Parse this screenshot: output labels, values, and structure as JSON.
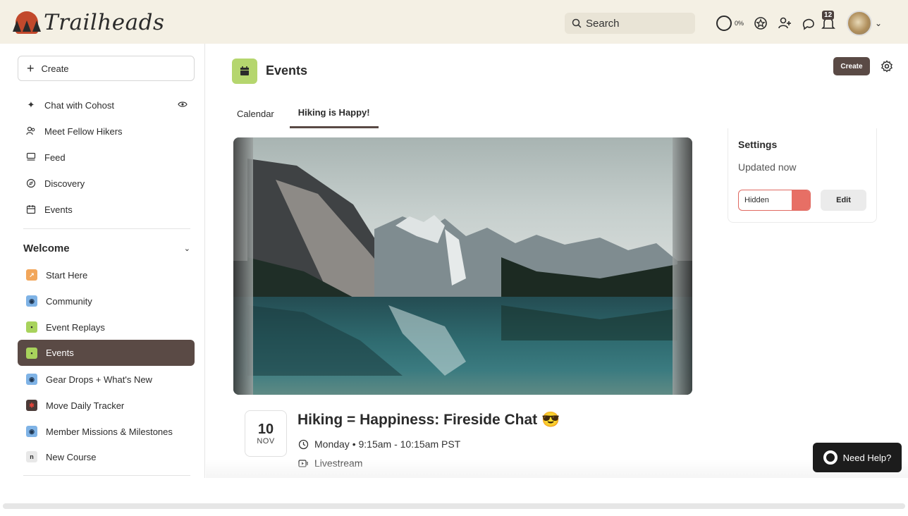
{
  "brand": {
    "name": "Trailheads"
  },
  "search": {
    "placeholder": "Search"
  },
  "header": {
    "progress_label": "0%",
    "notification_count": "12"
  },
  "sidebar": {
    "create_label": "Create",
    "top_items": [
      {
        "label": "Chat with Cohost",
        "icon": "sparkle-icon"
      },
      {
        "label": "Meet Fellow Hikers",
        "icon": "people-icon"
      },
      {
        "label": "Feed",
        "icon": "feed-icon"
      },
      {
        "label": "Discovery",
        "icon": "compass-icon"
      },
      {
        "label": "Events",
        "icon": "calendar-icon"
      }
    ],
    "section_title": "Welcome",
    "section_items": [
      {
        "label": "Start Here",
        "icon": "arrow-icon",
        "color": "#f2a65a"
      },
      {
        "label": "Community",
        "icon": "compass-icon",
        "color": "#7fb3e6"
      },
      {
        "label": "Event Replays",
        "icon": "calendar-icon",
        "color": "#a8d35c"
      },
      {
        "label": "Events",
        "icon": "calendar-icon",
        "color": "#a8d35c"
      },
      {
        "label": "Gear Drops + What's New",
        "icon": "compass-icon",
        "color": "#7fb3e6"
      },
      {
        "label": "Move Daily Tracker",
        "icon": "runner-icon",
        "color": "#4b3b38"
      },
      {
        "label": "Member Missions & Milestones",
        "icon": "compass-icon",
        "color": "#7fb3e6"
      },
      {
        "label": "New Course",
        "icon": "letter-n-icon",
        "color": "#e8e8e8",
        "glyph": "n"
      }
    ],
    "active_item": "Events"
  },
  "main": {
    "title": "Events",
    "create_label": "Create",
    "tabs": [
      {
        "label": "Calendar",
        "active": false
      },
      {
        "label": "Hiking is Happy!",
        "active": true
      }
    ],
    "event": {
      "day": "10",
      "month": "NOV",
      "title": "Hiking = Happiness: Fireside Chat 😎",
      "time": "Monday • 9:15am - 10:15am PST",
      "location": "Livestream"
    },
    "settings": {
      "title": "Settings",
      "updated": "Updated now",
      "visibility": "Hidden",
      "edit_label": "Edit"
    }
  },
  "help": {
    "label": "Need Help?"
  },
  "colors": {
    "accent": "#5a4a45",
    "header_bg": "#f4f0e4",
    "hidden_toggle": "#e76f65",
    "events_icon_bg": "#b5d66e"
  }
}
